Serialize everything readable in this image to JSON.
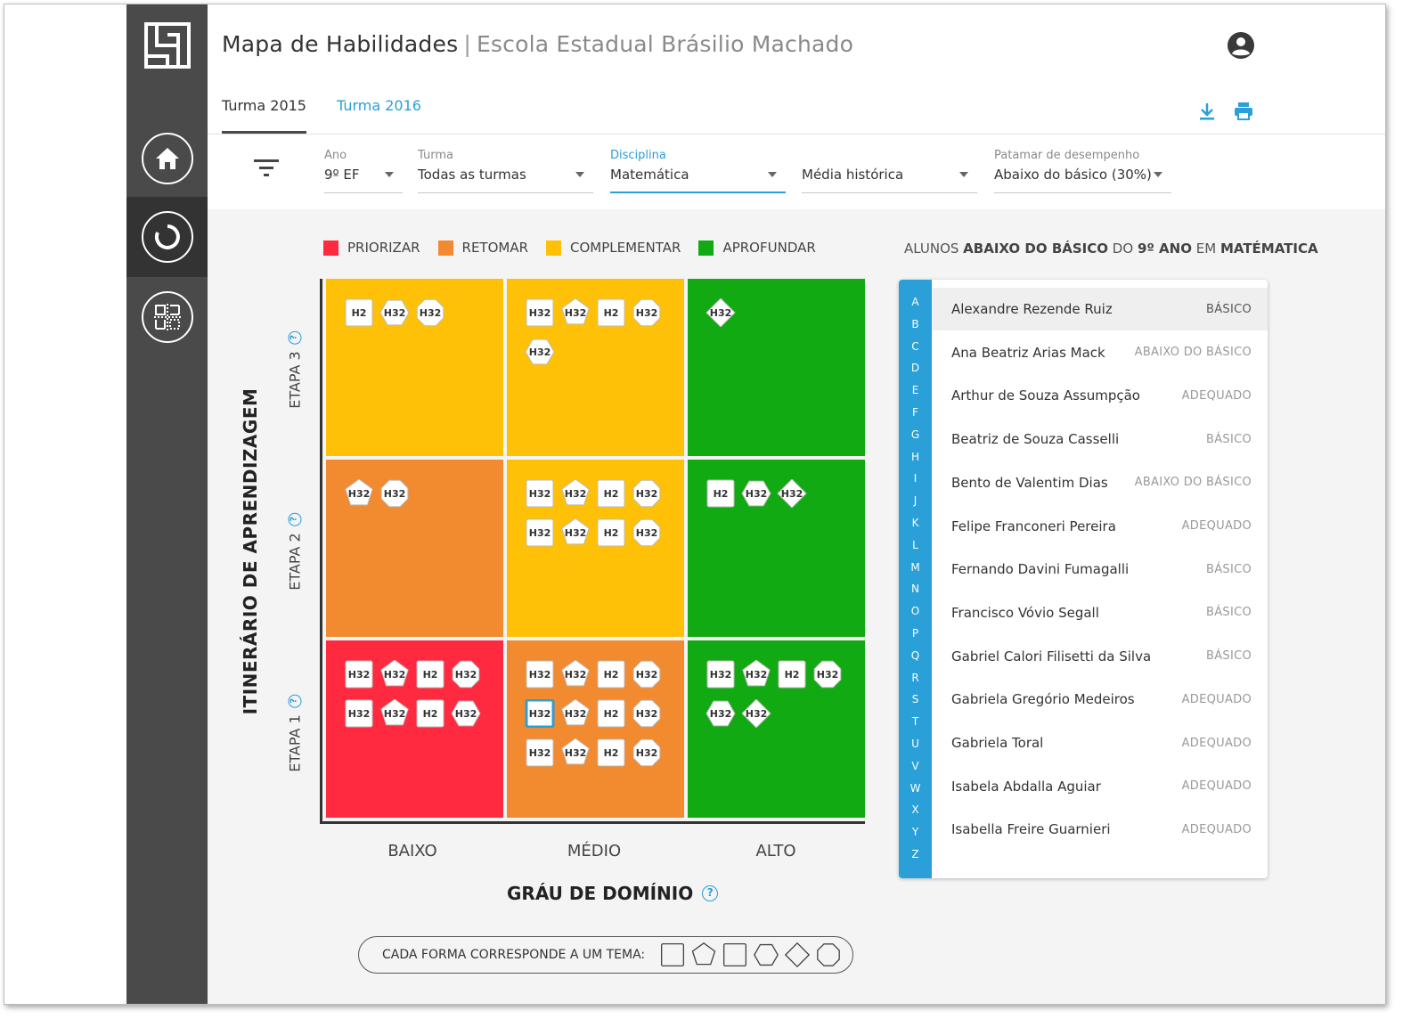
{
  "header": {
    "title": "Mapa de Habilidades",
    "separator": "|",
    "school": "Escola Estadual Brásilio Machado"
  },
  "tabs": [
    {
      "label": "Turma 2015",
      "active": true
    },
    {
      "label": "Turma 2016",
      "active": false
    }
  ],
  "filters": {
    "ano": {
      "label": "Ano",
      "value": "9º EF"
    },
    "turma": {
      "label": "Turma",
      "value": "Todas as turmas"
    },
    "disciplina": {
      "label": "Disciplina",
      "value": "Matemática"
    },
    "media": {
      "label": "",
      "value": "Média histórica"
    },
    "patamar": {
      "label": "Patamar de desempenho",
      "value": "Abaixo do básico (30%)"
    }
  },
  "legend": [
    {
      "label": "PRIORIZAR",
      "color": "#ff2a3f"
    },
    {
      "label": "RETOMAR",
      "color": "#f28a30"
    },
    {
      "label": "COMPLEMENTAR",
      "color": "#ffc107"
    },
    {
      "label": "APROFUNDAR",
      "color": "#12aa12"
    }
  ],
  "students_title": {
    "pre": "ALUNOS ",
    "bold1": "ABAIXO DO BÁSICO",
    "mid": " DO ",
    "bold2": "9º ANO",
    "mid2": " EM ",
    "bold3": "MATÉMATICA"
  },
  "matrix": {
    "y_axis_title": "ITINERÁRIO DE APRENDIZAGEM",
    "rows": [
      "ETAPA 3",
      "ETAPA 2",
      "ETAPA 1"
    ],
    "columns": [
      "BAIXO",
      "MÉDIO",
      "ALTO"
    ],
    "x_axis_title": "GRÁU DE DOMÍNIO",
    "cells": [
      {
        "row": 0,
        "col": 0,
        "color": "#ffc107",
        "chips": [
          [
            "square",
            "H2"
          ],
          [
            "hexagon",
            "H32"
          ],
          [
            "octagon",
            "H32"
          ]
        ]
      },
      {
        "row": 0,
        "col": 1,
        "color": "#ffc107",
        "chips": [
          [
            "square",
            "H32"
          ],
          [
            "pentagon",
            "H32"
          ],
          [
            "square",
            "H2"
          ],
          [
            "octagon",
            "H32"
          ],
          [
            "hexagon",
            "H32"
          ]
        ]
      },
      {
        "row": 0,
        "col": 2,
        "color": "#12aa12",
        "chips": [
          [
            "diamond",
            "H32"
          ]
        ]
      },
      {
        "row": 1,
        "col": 0,
        "color": "#f28a30",
        "chips": [
          [
            "pentagon",
            "H32"
          ],
          [
            "octagon",
            "H32"
          ]
        ]
      },
      {
        "row": 1,
        "col": 1,
        "color": "#ffc107",
        "chips": [
          [
            "square",
            "H32"
          ],
          [
            "pentagon",
            "H32"
          ],
          [
            "square",
            "H2"
          ],
          [
            "octagon",
            "H32"
          ],
          [
            "square",
            "H32"
          ],
          [
            "pentagon",
            "H32"
          ],
          [
            "square",
            "H2"
          ],
          [
            "octagon",
            "H32"
          ]
        ]
      },
      {
        "row": 1,
        "col": 2,
        "color": "#12aa12",
        "chips": [
          [
            "square",
            "H2"
          ],
          [
            "hexagon",
            "H32"
          ],
          [
            "diamond",
            "H32"
          ]
        ]
      },
      {
        "row": 2,
        "col": 0,
        "color": "#ff2a3f",
        "chips": [
          [
            "square",
            "H32"
          ],
          [
            "pentagon",
            "H32"
          ],
          [
            "square",
            "H2"
          ],
          [
            "octagon",
            "H32"
          ],
          [
            "square",
            "H32"
          ],
          [
            "pentagon",
            "H32"
          ],
          [
            "square",
            "H2"
          ],
          [
            "hexagon",
            "H32"
          ]
        ]
      },
      {
        "row": 2,
        "col": 1,
        "color": "#f28a30",
        "chips": [
          [
            "square",
            "H32"
          ],
          [
            "pentagon",
            "H32"
          ],
          [
            "square",
            "H2"
          ],
          [
            "octagon",
            "H32"
          ],
          [
            "square",
            "H32",
            "selected"
          ],
          [
            "pentagon",
            "H32"
          ],
          [
            "square",
            "H2"
          ],
          [
            "octagon",
            "H32"
          ],
          [
            "square",
            "H32"
          ],
          [
            "pentagon",
            "H32"
          ],
          [
            "square",
            "H2"
          ],
          [
            "octagon",
            "H32"
          ]
        ]
      },
      {
        "row": 2,
        "col": 2,
        "color": "#12aa12",
        "chips": [
          [
            "square",
            "H32"
          ],
          [
            "pentagon",
            "H32"
          ],
          [
            "square",
            "H2"
          ],
          [
            "octagon",
            "H32"
          ],
          [
            "hexagon",
            "H32"
          ],
          [
            "diamond",
            "H32"
          ]
        ]
      }
    ]
  },
  "shapes_legend": {
    "label": "CADA FORMA CORRESPONDE A UM TEMA:",
    "shapes": [
      "square",
      "pentagon",
      "square",
      "hexagon",
      "diamond",
      "octagon"
    ]
  },
  "alphabet": [
    "A",
    "B",
    "C",
    "D",
    "E",
    "F",
    "G",
    "H",
    "I",
    "J",
    "K",
    "L",
    "M",
    "N",
    "O",
    "P",
    "Q",
    "R",
    "S",
    "T",
    "U",
    "V",
    "W",
    "X",
    "Y",
    "Z"
  ],
  "students": [
    {
      "name": "Alexandre Rezende Ruiz",
      "level": "BÁSICO"
    },
    {
      "name": "Ana Beatriz Arias Mack",
      "level": "ABAIXO DO BÁSICO"
    },
    {
      "name": "Arthur de Souza Assumpção",
      "level": "ADEQUADO"
    },
    {
      "name": "Beatriz de Souza Casselli",
      "level": "BÁSICO"
    },
    {
      "name": "Bento de Valentim Dias",
      "level": "ABAIXO DO BÁSICO"
    },
    {
      "name": "Felipe Franconeri Pereira",
      "level": "ADEQUADO"
    },
    {
      "name": "Fernando Davini Fumagalli",
      "level": "BÁSICO"
    },
    {
      "name": "Francisco Vóvio Segall",
      "level": "BÁSICO"
    },
    {
      "name": "Gabriel Calori Filisetti da Silva",
      "level": "BÁSICO"
    },
    {
      "name": "Gabriela Gregório Medeiros",
      "level": "ADEQUADO"
    },
    {
      "name": "Gabriela Toral",
      "level": "ADEQUADO"
    },
    {
      "name": "Isabela Abdalla Aguiar",
      "level": "ADEQUADO"
    },
    {
      "name": "Isabella Freire Guarnieri",
      "level": "ADEQUADO"
    }
  ],
  "icons": {
    "logo": "logo-icon",
    "home": "home-icon",
    "cycle": "circle-progress-icon",
    "grid": "grid-icon",
    "user": "user-account-icon",
    "download": "download-icon",
    "print": "print-icon",
    "filter": "filter-icon",
    "help": "help-icon"
  },
  "colors": {
    "accent": "#2a9fd8",
    "sidebar": "#4a4a4a",
    "sidebar_active": "#333333"
  }
}
